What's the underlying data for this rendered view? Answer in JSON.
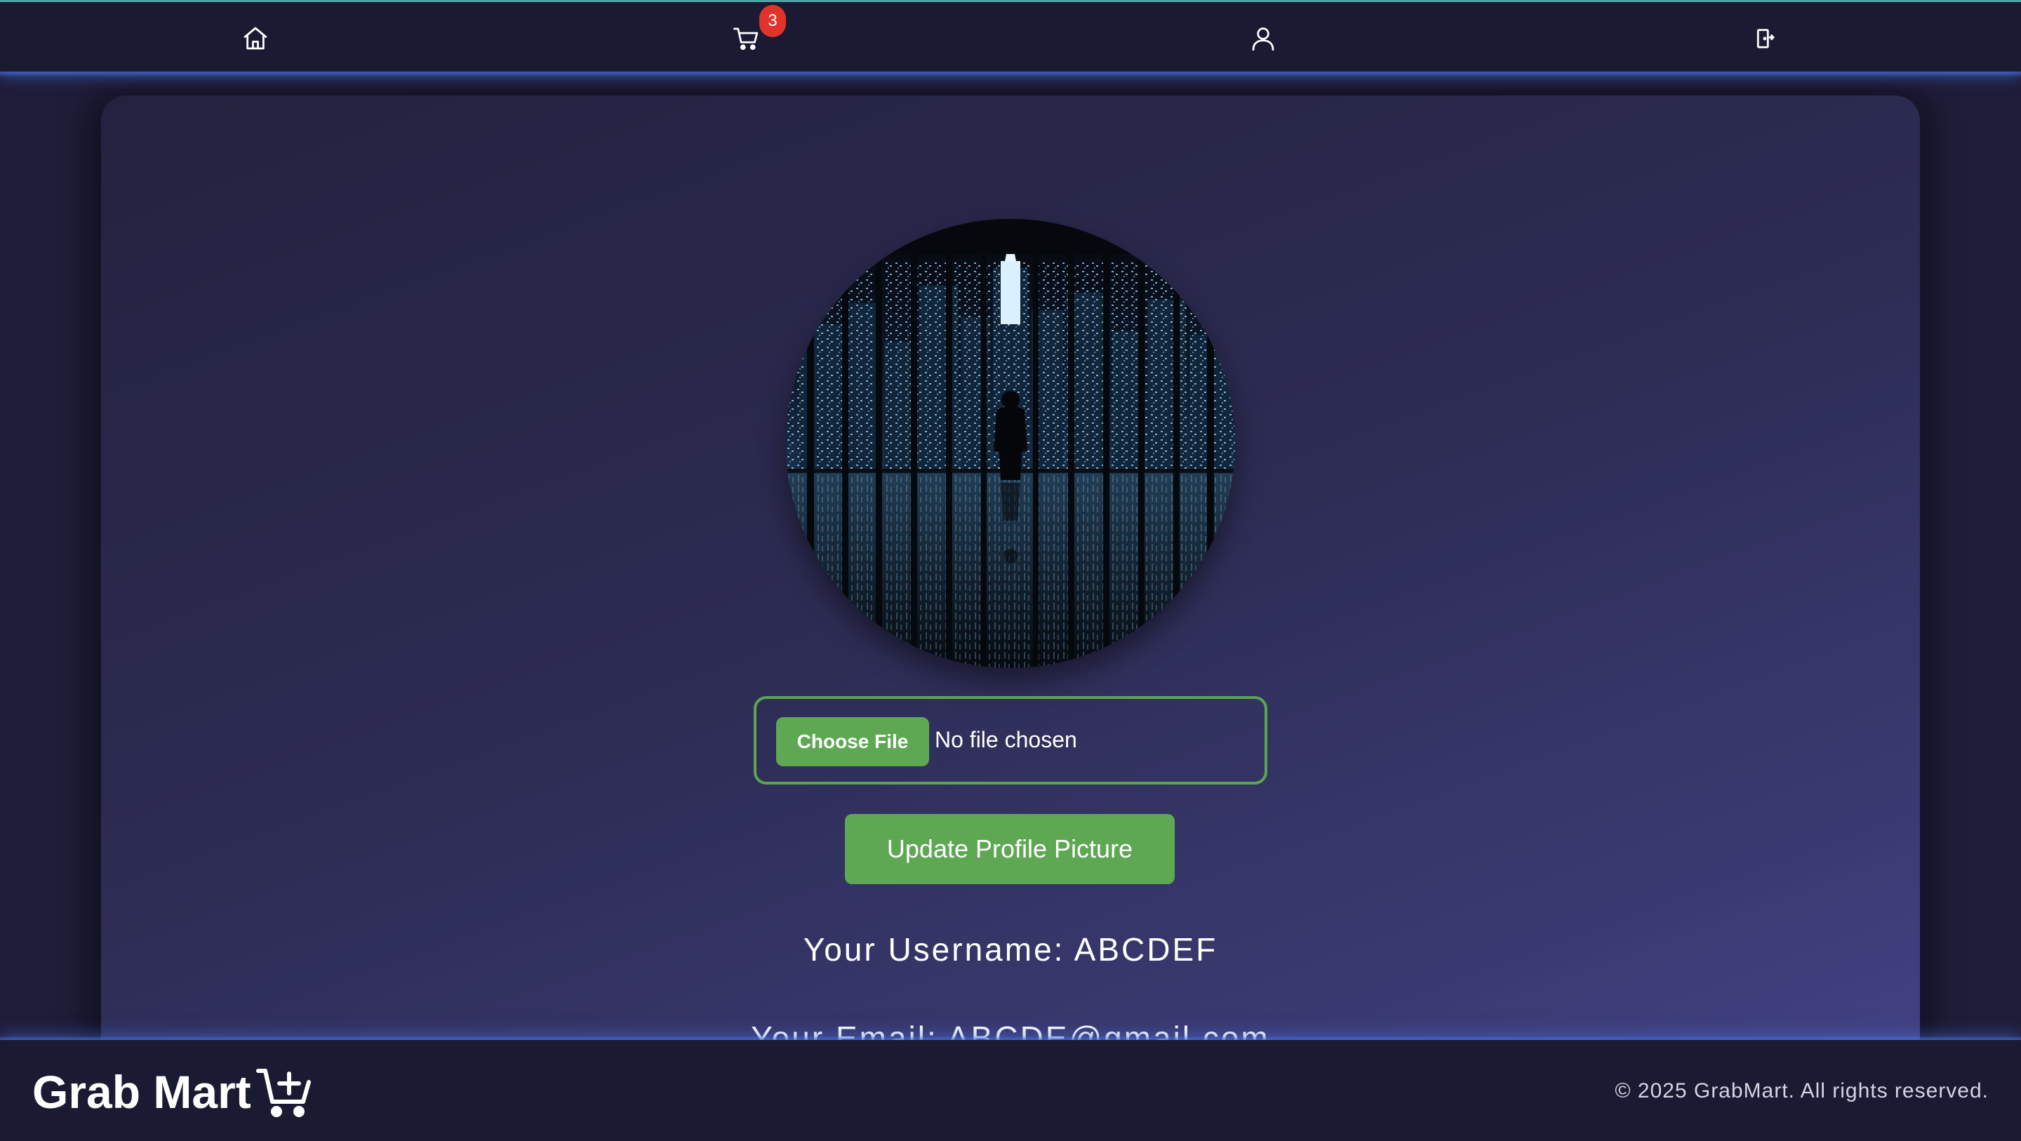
{
  "nav": {
    "icons": [
      "home-icon",
      "cart-icon",
      "user-icon",
      "logout-icon"
    ],
    "cart_count": "3"
  },
  "profile": {
    "choose_file_label": "Choose File",
    "no_file_text": "No file chosen",
    "update_button": "Update Profile Picture",
    "username_line": "Your Username: ABCDEF",
    "email_line": "Your Email: ABCDE@gmail.com"
  },
  "footer": {
    "brand": "Grab Mart",
    "brand_icon": "cart-plus-icon",
    "copyright": "© 2025 GrabMart. All rights reserved."
  },
  "colors": {
    "accent_green": "#5ea854",
    "badge_red": "#e0332b",
    "nav_bg": "#1b1a33"
  }
}
